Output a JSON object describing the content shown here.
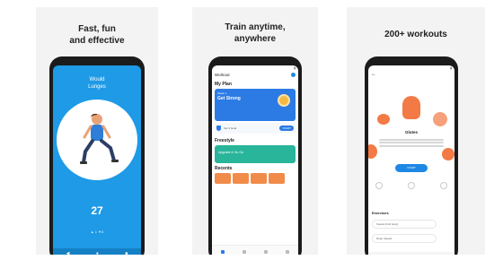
{
  "panels": [
    {
      "caption": "Fast, fun\nand effective",
      "screen": {
        "exercise_name": "Would\nLunges",
        "timer": "27",
        "progress": "▲ 1 ▼8"
      }
    },
    {
      "caption": "Train anytime,\nanywhere",
      "screen": {
        "title": "Workout",
        "section_plan": "My Plan",
        "plan_small": "Week 1",
        "plan_big": "Get Strong",
        "row_text": "Set 3 Goal",
        "row_button": "START",
        "section_freestyle": "Freestyle",
        "freestyle_text": "Upgrade & Go Go",
        "section_recents": "Recents"
      }
    },
    {
      "caption": "200+ workouts",
      "screen": {
        "muscle_title": "Glutes",
        "start_button": "START",
        "section_exercises": "Exercises",
        "exercise_1": "Squats (Full body)",
        "exercise_2": "Deep Squats"
      }
    }
  ]
}
